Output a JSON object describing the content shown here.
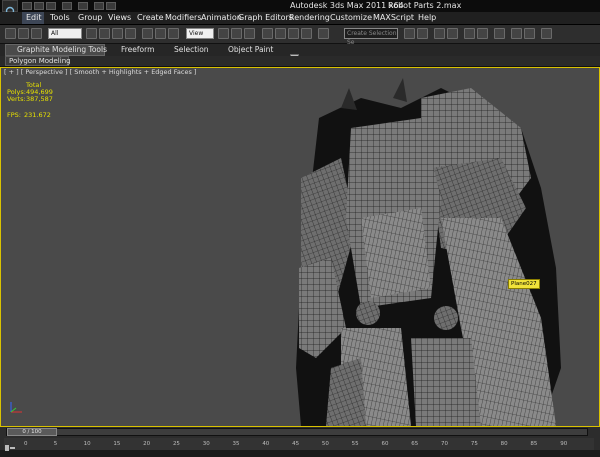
{
  "window": {
    "title": "Autodesk 3ds Max  2011 x64",
    "file": "Robot Parts 2.max"
  },
  "menu": [
    "Edit",
    "Tools",
    "Group",
    "Views",
    "Create",
    "Modifiers",
    "Animation",
    "Graph Editors",
    "Rendering",
    "Customize",
    "MAXScript",
    "Help"
  ],
  "toolbar": {
    "selection_filter": "All",
    "reference_coord": "View",
    "named_selection_placeholder": "Create Selection Se"
  },
  "ribbon": {
    "tabs": [
      "Graphite Modeling Tools",
      "Freeform",
      "Selection",
      "Object Paint"
    ],
    "active_panel": "Polygon Modeling"
  },
  "viewport": {
    "label": "[ + ] [ Perspective ] [ Smooth + Highlights + Edged Faces ]",
    "stats": {
      "header": "Total",
      "polys_label": "Polys:",
      "polys_value": "494,699",
      "verts_label": "Verts:",
      "verts_value": "387,587",
      "fps_label": "FPS:",
      "fps_value": "231.672"
    },
    "object_tooltip": "Plane027"
  },
  "timeline": {
    "frame": "0 / 100",
    "ticks": [
      "0",
      "5",
      "10",
      "15",
      "20",
      "25",
      "30",
      "35",
      "40",
      "45",
      "50",
      "55",
      "60",
      "65",
      "70",
      "75",
      "80",
      "85",
      "90"
    ]
  },
  "colors": {
    "viewport_bg": "#4a4a4a",
    "active_border": "#d9c200",
    "stats_text": "#e6e000",
    "mesh_fill": "#7a7a7a",
    "wire": "#1c1c1c"
  }
}
